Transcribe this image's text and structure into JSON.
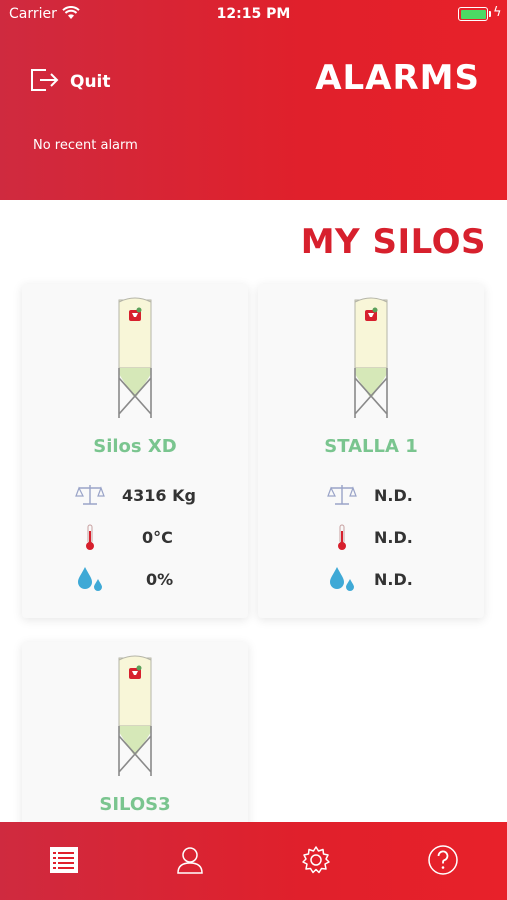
{
  "status_bar": {
    "carrier": "Carrier",
    "time": "12:15 PM",
    "wifi_icon": "wifi-icon",
    "battery_icon": "battery-icon",
    "battery_color": "#4cd964"
  },
  "header": {
    "quit_label": "Quit",
    "quit_icon": "logout-icon",
    "title": "ALARMS",
    "alarm_status": "No recent alarm",
    "gradient_start": "#cf2a3f",
    "gradient_end": "#e8212a"
  },
  "main": {
    "title": "MY SILOS",
    "title_color": "#d7202d",
    "silos": [
      {
        "name": "Silos XD",
        "weight": "4316 Kg",
        "temperature": "0°C",
        "humidity": "0%"
      },
      {
        "name": "STALLA 1",
        "weight": "N.D.",
        "temperature": "N.D.",
        "humidity": "N.D."
      },
      {
        "name": "SILOS3"
      }
    ],
    "name_color": "#7ac58f",
    "icons": {
      "weight": "scale-icon",
      "temperature": "thermometer-icon",
      "humidity": "water-drops-icon"
    }
  },
  "tabbar": {
    "tabs": [
      {
        "icon": "list-icon",
        "selected": true
      },
      {
        "icon": "user-icon",
        "selected": false
      },
      {
        "icon": "gear-icon",
        "selected": false
      },
      {
        "icon": "help-icon",
        "selected": false
      }
    ]
  }
}
